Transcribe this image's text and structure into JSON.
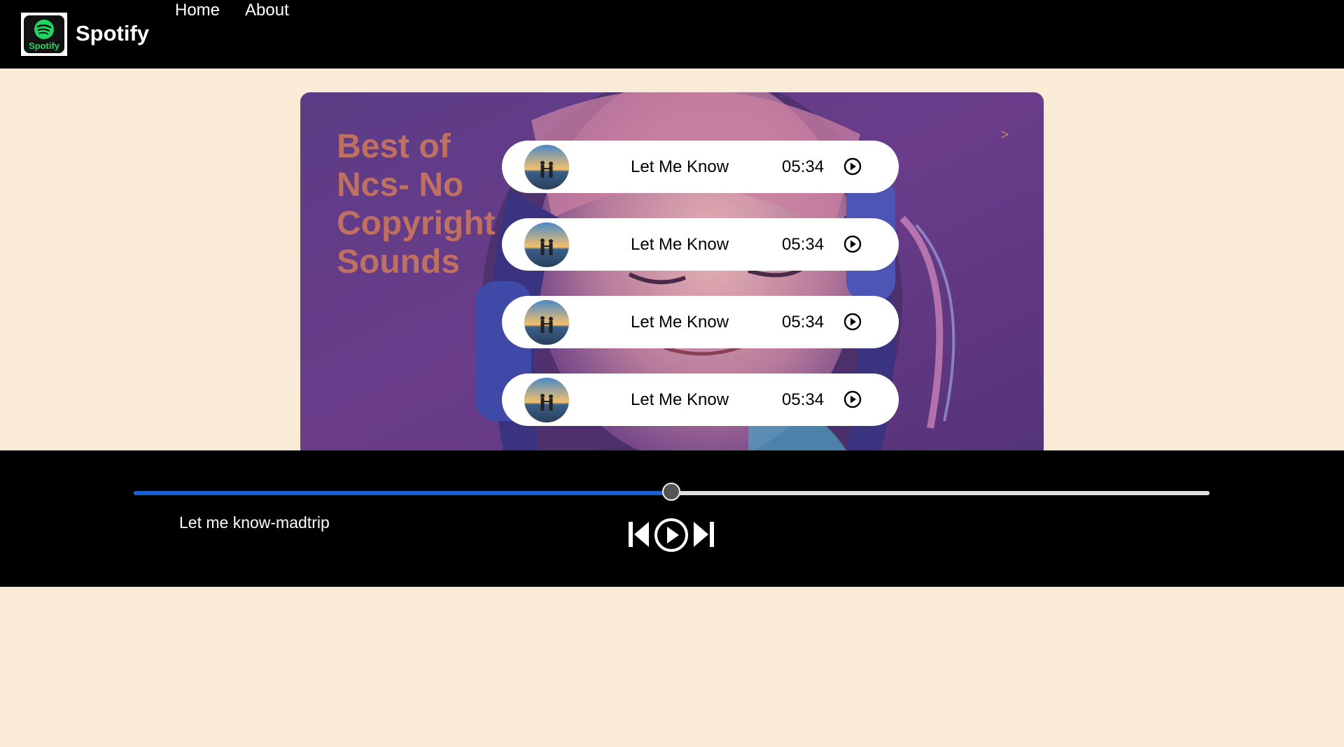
{
  "app": {
    "name": "Spotify",
    "logo_text": "Spotify",
    "brand_color": "#1ed760"
  },
  "nav": {
    "links": [
      {
        "label": "Home"
      },
      {
        "label": "About"
      }
    ]
  },
  "playlist": {
    "title": "Best of Ncs- No Copyright Sounds",
    "next_label": ">",
    "songs": [
      {
        "title": "Let Me Know",
        "duration": "05:34",
        "icon": "play-circle-icon"
      },
      {
        "title": "Let Me Know",
        "duration": "05:34",
        "icon": "play-circle-icon"
      },
      {
        "title": "Let Me Know",
        "duration": "05:34",
        "icon": "play-circle-icon"
      },
      {
        "title": "Let Me Know",
        "duration": "05:34",
        "icon": "play-circle-icon"
      }
    ]
  },
  "player": {
    "now_playing": "Let me know-madtrip",
    "progress": 0.5,
    "colors": {
      "progress_fill": "#1a5fd6",
      "track": "#e0e0e0"
    },
    "controls": [
      "previous-icon",
      "play-icon",
      "next-icon"
    ]
  },
  "theme": {
    "page_background": "#faebd7",
    "bar_background": "#000000",
    "title_color": "#c07060"
  }
}
